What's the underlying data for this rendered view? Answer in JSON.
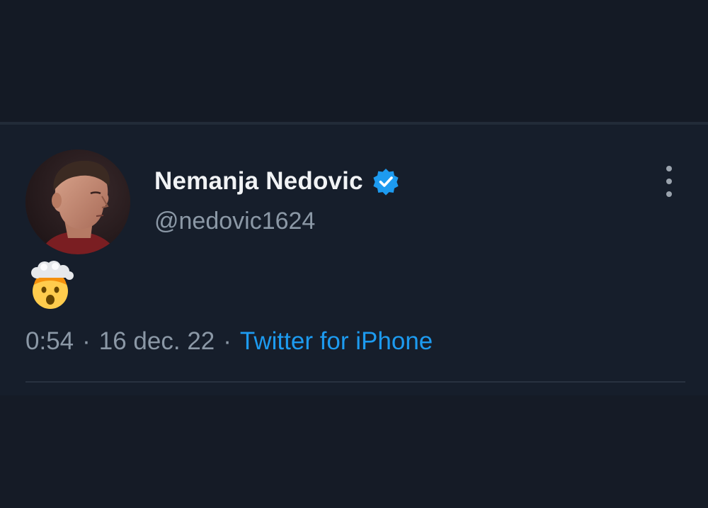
{
  "tweet": {
    "author": {
      "display_name": "Nemanja Nedovic",
      "handle": "@nedovic1624",
      "verified": true,
      "avatar_icon": "user-avatar-photo"
    },
    "body": {
      "emoji": "exploding-head-emoji"
    },
    "meta": {
      "time": "0:54",
      "separator": "·",
      "date": "16 dec. 22",
      "source": "Twitter for iPhone"
    },
    "more_icon": "more-vertical-icon"
  },
  "colors": {
    "background": "#151b26",
    "card": "#161e2b",
    "text_primary": "#f1f3f5",
    "text_muted": "#8b98a6",
    "link": "#1d9bf0",
    "verified_badge": "#1d9bf0"
  }
}
